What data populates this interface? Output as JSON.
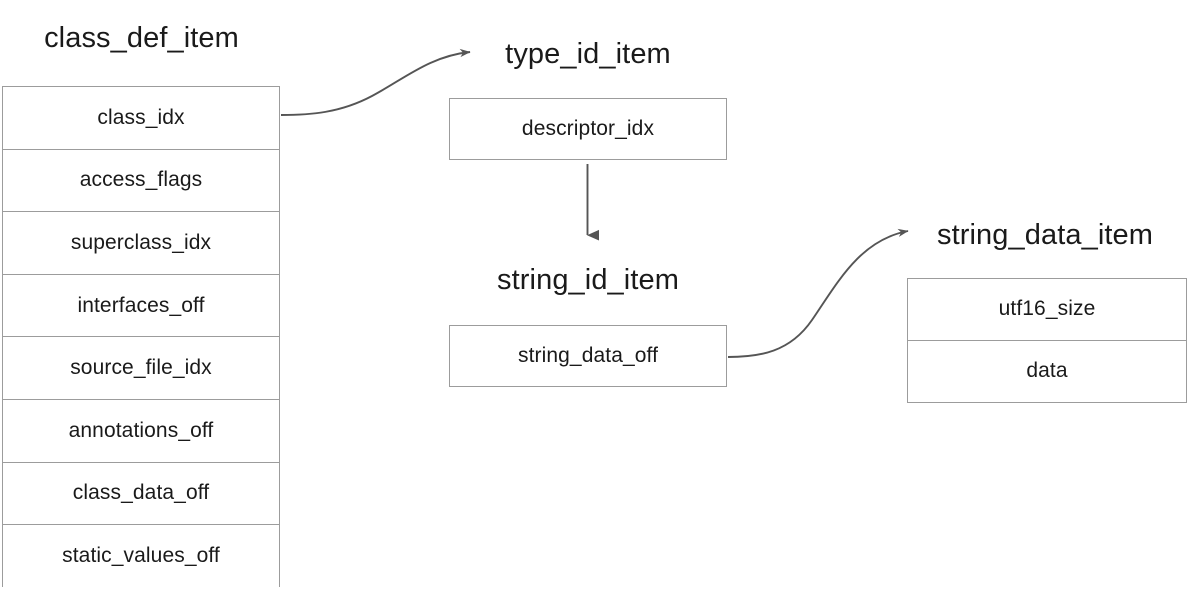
{
  "diagram": {
    "title_font_size": 29,
    "row_font_size": 21,
    "border_color": "#9c9c9c",
    "text_color": "#1a1a1a",
    "arrow_color": "#555555",
    "background": "#ffffff",
    "structs": [
      {
        "id": "class_def_item",
        "name": "class_def_item",
        "fields": [
          "class_idx",
          "access_flags",
          "superclass_idx",
          "interfaces_off",
          "source_file_idx",
          "annotations_off",
          "class_data_off",
          "static_values_off"
        ]
      },
      {
        "id": "type_id_item",
        "name": "type_id_item",
        "fields": [
          "descriptor_idx"
        ]
      },
      {
        "id": "string_id_item",
        "name": "string_id_item",
        "fields": [
          "string_data_off"
        ]
      },
      {
        "id": "string_data_item",
        "name": "string_data_item",
        "fields": [
          "utf16_size",
          "data"
        ]
      }
    ],
    "edges": [
      {
        "id": "class-idx-to-type-id-item",
        "from_struct": "class_def_item",
        "from_field": "class_idx",
        "to_struct": "type_id_item",
        "style": "curved",
        "arrowhead": "open"
      },
      {
        "id": "descriptor-idx-to-string-id-item",
        "from_struct": "type_id_item",
        "from_field": "descriptor_idx",
        "to_struct": "string_id_item",
        "style": "straight-vertical",
        "arrowhead": "filled"
      },
      {
        "id": "string-data-off-to-string-data-item",
        "from_struct": "string_id_item",
        "from_field": "string_data_off",
        "to_struct": "string_data_item",
        "style": "curved",
        "arrowhead": "open"
      }
    ]
  }
}
